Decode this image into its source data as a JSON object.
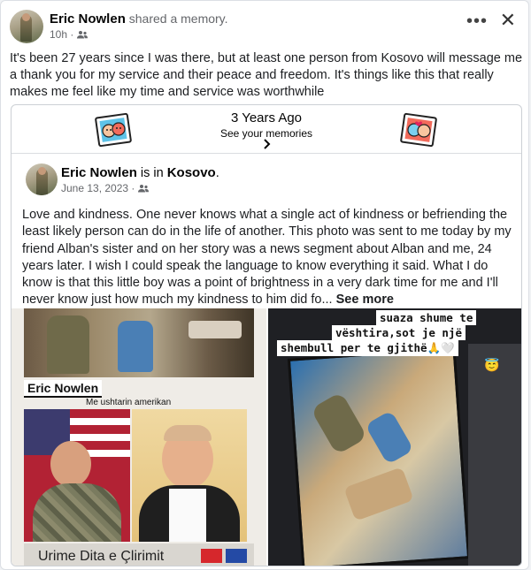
{
  "header": {
    "author": "Eric Nowlen",
    "action": " shared a memory.",
    "time": "10h ·",
    "more_label": "•••",
    "close_label": "✕"
  },
  "post": {
    "text": "It's been 27 years since I was there, but at least one person from Kosovo will message me a thank you for my service and their peace and freedom. It's things like this that really makes me feel like my time and service was worthwhile"
  },
  "memory": {
    "title": "3 Years Ago",
    "subtitle": "See your memories",
    "chevron": "›"
  },
  "shared": {
    "author": "Eric Nowlen",
    "is_in": " is in ",
    "location": "Kosovo",
    "period": ".",
    "date": "June 13, 2023 ·",
    "text": "Love and kindness. One never knows what a single act of kindness or befriending the least likely person can do in the life of another. This photo was sent to me today by my friend Alban's sister and on her story was a news segment about Alban and me, 24 years later. I wish I could speak the language to know everything it said. What I do know is that this little boy was a point of brightness in a very dark time for me and I'll never know just how much my kindness to him did fo...",
    "see_more": "See more"
  },
  "photo1": {
    "name_label": "Eric Nowlen",
    "caption": "Me ushtarin amerikan",
    "bottom_text": "Urime Dita e Çlirimit"
  },
  "photo2": {
    "line1": "suaza shume te",
    "line2": "vështira,sot je një",
    "line3": "shembull per te gjithë🙏🤍",
    "emoji": "😇"
  },
  "colors": {
    "secondary_text": "#65676b",
    "divider": "#dadde1"
  },
  "icons": [
    "friends-icon",
    "more-icon",
    "close-icon",
    "memory-sticker-left",
    "memory-sticker-right",
    "chevron-icon"
  ]
}
